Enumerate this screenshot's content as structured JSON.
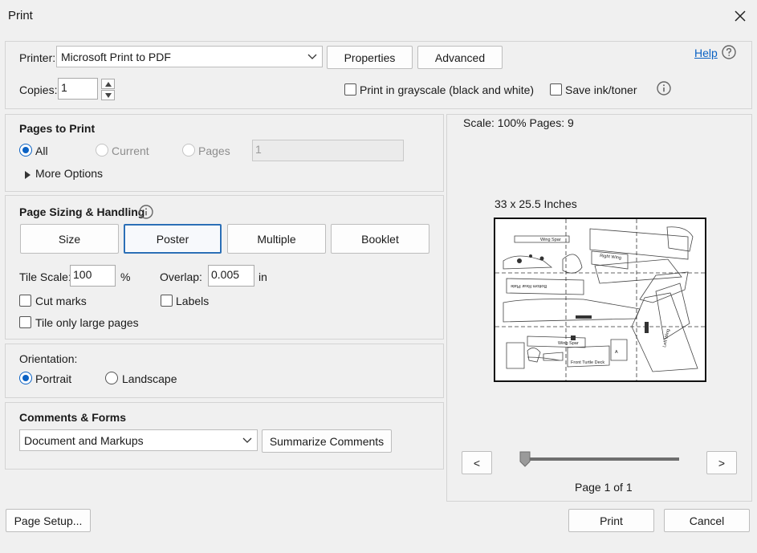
{
  "window": {
    "title": "Print"
  },
  "printer": {
    "label": "Printer:",
    "selected": "Microsoft Print to PDF",
    "properties_label": "Properties",
    "advanced_label": "Advanced",
    "help_label": "Help"
  },
  "copies": {
    "label": "Copies:",
    "value": "1"
  },
  "options": {
    "grayscale_label": "Print in grayscale (black and white)",
    "grayscale_checked": false,
    "save_ink_label": "Save ink/toner",
    "save_ink_checked": false
  },
  "pages_to_print": {
    "heading": "Pages to Print",
    "all_label": "All",
    "current_label": "Current",
    "pages_label": "Pages",
    "pages_value": "1",
    "selected": "All",
    "more_options_label": "More Options"
  },
  "sizing": {
    "heading": "Page Sizing & Handling",
    "buttons": [
      "Size",
      "Poster",
      "Multiple",
      "Booklet"
    ],
    "active": "Poster",
    "tile_scale_label": "Tile Scale:",
    "tile_scale_value": "100",
    "tile_scale_unit": "%",
    "overlap_label": "Overlap:",
    "overlap_value": "0.005",
    "overlap_unit": "in",
    "cut_marks_label": "Cut marks",
    "labels_label": "Labels",
    "tile_large_label": "Tile only large pages"
  },
  "orientation": {
    "heading": "Orientation:",
    "portrait_label": "Portrait",
    "landscape_label": "Landscape",
    "selected": "Portrait"
  },
  "comments": {
    "heading": "Comments & Forms",
    "selected": "Document and Markups",
    "summarize_label": "Summarize Comments"
  },
  "preview": {
    "scale_text": "Scale: 100% Pages: 9",
    "size_text": "33 x 25.5 Inches",
    "prev_label": "<",
    "next_label": ">",
    "page_text": "Page 1 of 1",
    "slider_value": 0,
    "part_labels": [
      "Wing Spar",
      "Right Wing",
      "Bottom Rear Plate",
      "Wing Spar",
      "Left Wing",
      "Front Turtle Deck",
      "A"
    ]
  },
  "footer": {
    "page_setup_label": "Page Setup...",
    "print_label": "Print",
    "cancel_label": "Cancel"
  },
  "icons": {
    "close": "close-icon",
    "help": "question-circle-icon",
    "info": "info-icon",
    "dropdown": "chevron-down-icon",
    "expand": "triangle-right-icon"
  },
  "colors": {
    "accent": "#0b62c4",
    "active_border": "#2b6fb6"
  }
}
